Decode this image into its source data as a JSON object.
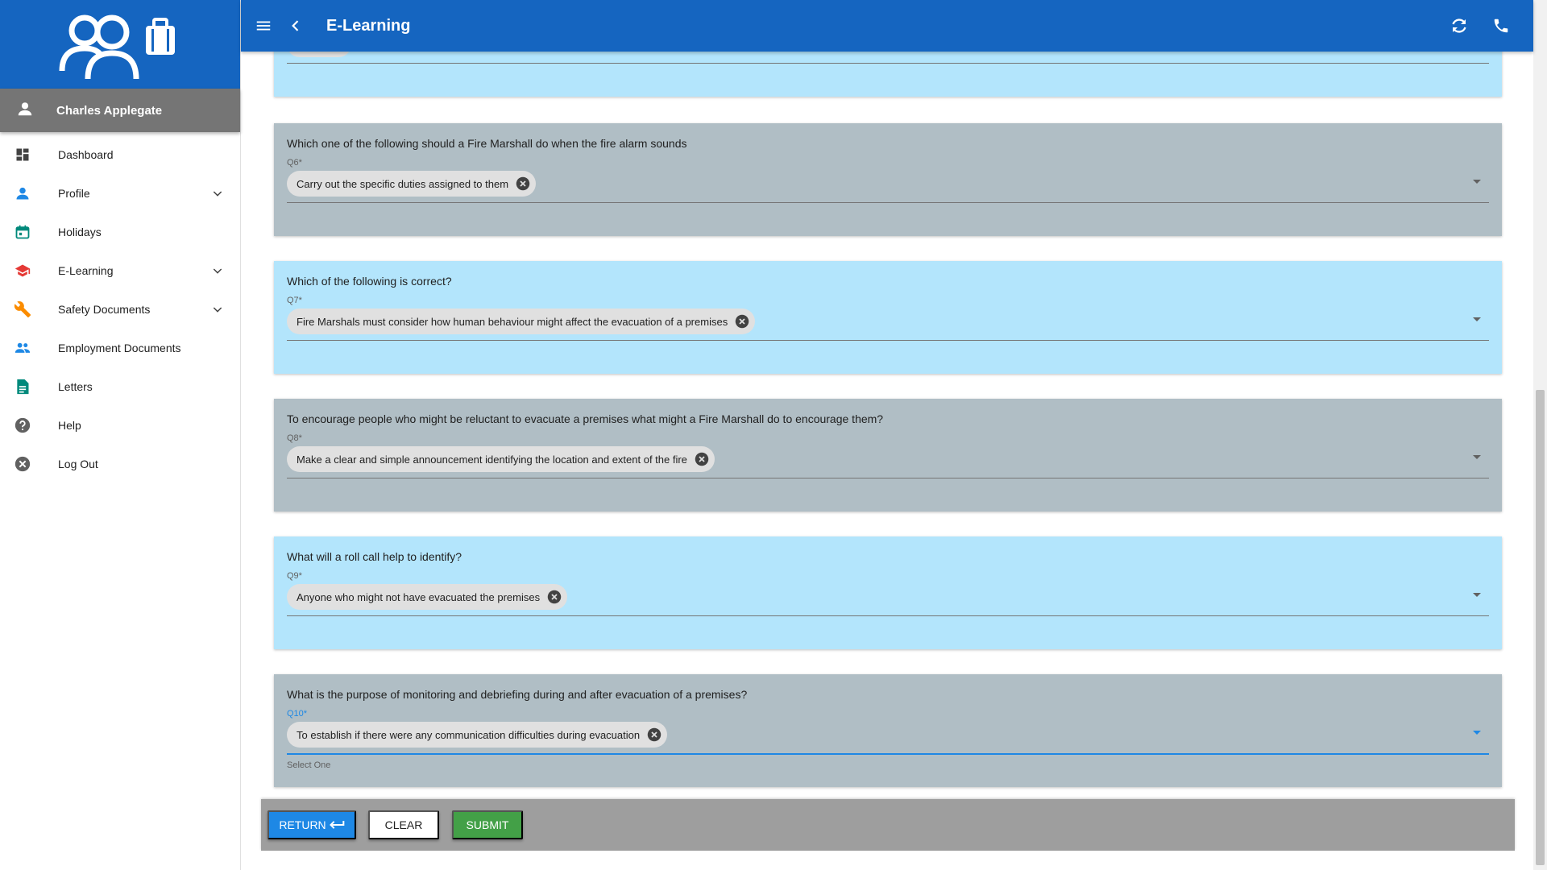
{
  "app": {
    "title": "E-Learning",
    "brand_color": "#1565c0"
  },
  "sidebar": {
    "user_name": "Charles Applegate",
    "items": [
      {
        "label": "Dashboard",
        "icon": "dashboard-icon",
        "color": "#424242"
      },
      {
        "label": "Profile",
        "icon": "person-icon",
        "color": "#1e88e5",
        "expandable": true
      },
      {
        "label": "Holidays",
        "icon": "calendar-icon",
        "color": "#00897b"
      },
      {
        "label": "E-Learning",
        "icon": "school-icon",
        "color": "#e53935",
        "expandable": true
      },
      {
        "label": "Safety Documents",
        "icon": "wrench-icon",
        "color": "#fb8c00",
        "expandable": true
      },
      {
        "label": "Employment Documents",
        "icon": "people-icon",
        "color": "#1e88e5"
      },
      {
        "label": "Letters",
        "icon": "document-icon",
        "color": "#00897b"
      },
      {
        "label": "Help",
        "icon": "help-icon",
        "color": "#616161"
      },
      {
        "label": "Log Out",
        "icon": "logout-icon",
        "color": "#616161"
      }
    ]
  },
  "questions": [
    {
      "number": "Q6*",
      "text": "Which one of the following should a Fire Marshall do when the fire alarm sounds",
      "answer": "Carry out the specific duties assigned to them"
    },
    {
      "number": "Q7*",
      "text": "Which of the following is correct?",
      "answer": "Fire Marshals must consider how human behaviour might affect the evacuation of a premises"
    },
    {
      "number": "Q8*",
      "text": "To encourage people who might be reluctant to evacuate a premises what might a Fire Marshall do to encourage them?",
      "answer": "Make a clear and simple announcement identifying the location and extent of the fire"
    },
    {
      "number": "Q9*",
      "text": "What will a roll call help to identify?",
      "answer": "Anyone who might not have evacuated the premises"
    },
    {
      "number": "Q10*",
      "text": "What is the purpose of monitoring and debriefing during and after evacuation of a premises?",
      "answer": "To establish if there were any communication difficulties during evacuation",
      "helper": "Select One"
    }
  ],
  "footer": {
    "return_label": "RETURN",
    "clear_label": "CLEAR",
    "submit_label": "SUBMIT"
  }
}
